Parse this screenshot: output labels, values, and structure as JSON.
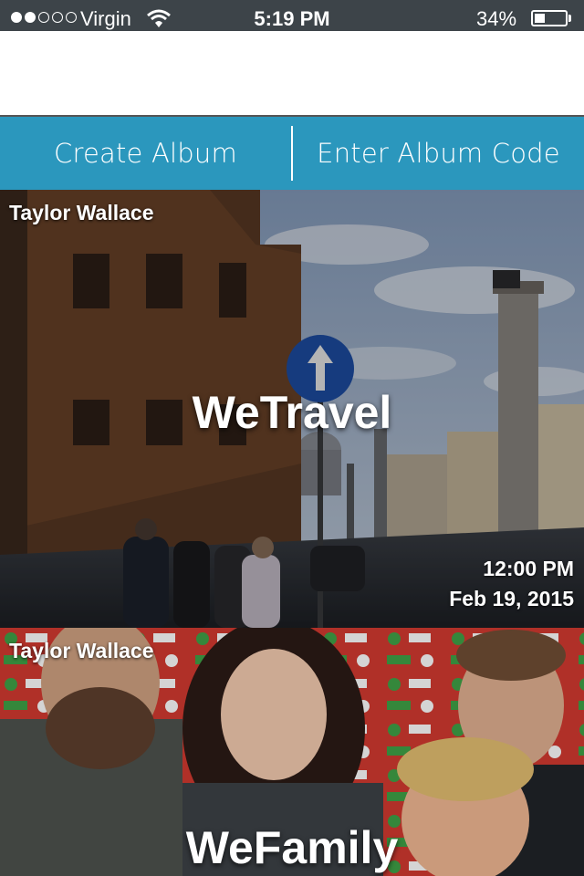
{
  "status_bar": {
    "carrier": "Virgin",
    "time": "5:19 PM",
    "battery_percent": "34%",
    "battery_level": 0.34,
    "signal_bars": 2,
    "signal_total": 5
  },
  "actions": {
    "create_album": "Create Album",
    "enter_code": "Enter Album Code",
    "accent_color": "#2b97bd"
  },
  "albums": [
    {
      "owner": "Taylor Wallace",
      "title": "WeTravel",
      "time": "12:00 PM",
      "date": "Feb 19, 2015"
    },
    {
      "owner": "Taylor Wallace",
      "title": "WeFamily"
    }
  ]
}
